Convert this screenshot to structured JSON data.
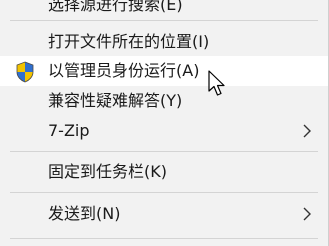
{
  "context_menu": {
    "items": [
      {
        "label": "选择源进行搜索(E)",
        "partial": true
      },
      {
        "label": "打开文件所在的位置(I)"
      },
      {
        "label": "以管理员身份运行(A)",
        "icon": "uac-shield-icon",
        "hovered": true
      },
      {
        "label": "兼容性疑难解答(Y)"
      },
      {
        "label": "7-Zip",
        "submenu": true
      },
      {
        "label": "固定到任务栏(K)"
      },
      {
        "label": "发送到(N)",
        "submenu": true
      }
    ]
  },
  "colors": {
    "menu_bg": "#f2f2f2",
    "hover_bg": "#ffffff",
    "separator": "#d4d4d4",
    "shield_blue": "#2f6fcf",
    "shield_yellow": "#f2c300"
  }
}
